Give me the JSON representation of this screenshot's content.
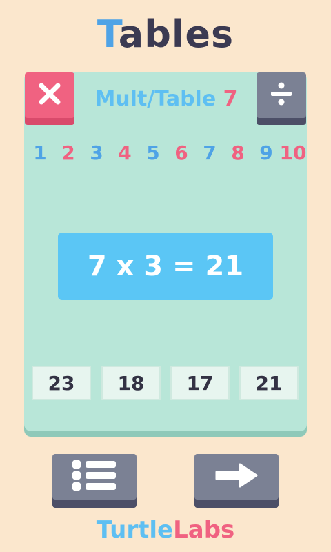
{
  "app": {
    "title_first": "T",
    "title_rest": "ables"
  },
  "header": {
    "label": "Mult/Table",
    "table_number": "7"
  },
  "numbers": [
    {
      "label": "1",
      "color": "#4fa3e6"
    },
    {
      "label": "2",
      "color": "#f06281"
    },
    {
      "label": "3",
      "color": "#4fa3e6"
    },
    {
      "label": "4",
      "color": "#f06281"
    },
    {
      "label": "5",
      "color": "#4fa3e6"
    },
    {
      "label": "6",
      "color": "#f06281"
    },
    {
      "label": "7",
      "color": "#4fa3e6"
    },
    {
      "label": "8",
      "color": "#f06281"
    },
    {
      "label": "9",
      "color": "#4fa3e6"
    },
    {
      "label": "10",
      "color": "#f06281"
    }
  ],
  "question": {
    "text": "7 x 3 = 21"
  },
  "answers": [
    "23",
    "18",
    "17",
    "21"
  ],
  "footer": {
    "brand_first": "Turtle",
    "brand_second": "Labs"
  },
  "icons": {
    "left_top": "close-icon",
    "right_top": "divide-icon",
    "bottom_left": "list-icon",
    "bottom_right": "arrow-right-icon"
  },
  "colors": {
    "background": "#fbe7cd",
    "panel": "#b8e6d8",
    "accent_blue": "#5ebff2",
    "accent_pink": "#f06281",
    "dark_button": "#7b8194"
  }
}
